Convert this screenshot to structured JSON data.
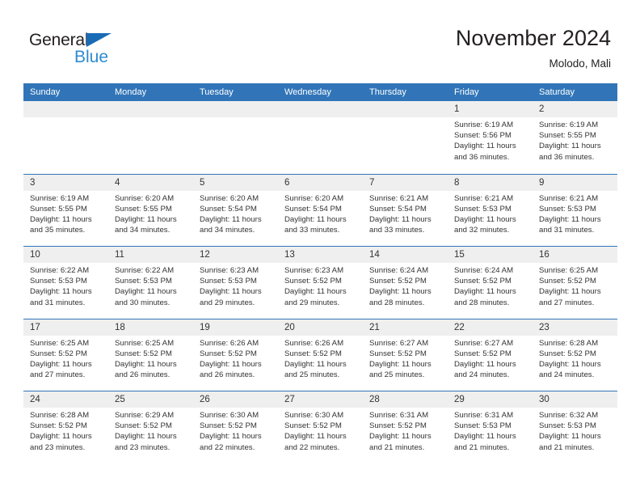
{
  "brand": {
    "name_part1": "General",
    "name_part2": "Blue",
    "flag_icon": "blue-triangle-flag",
    "color_dark": "#231f20",
    "color_blue": "#2e8bd0"
  },
  "header": {
    "title": "November 2024",
    "subtitle": "Molodo, Mali",
    "weekday_header_bg": "#3175b8",
    "weekday_header_fg": "#ffffff"
  },
  "weekdays": [
    "Sunday",
    "Monday",
    "Tuesday",
    "Wednesday",
    "Thursday",
    "Friday",
    "Saturday"
  ],
  "weeks": [
    [
      {
        "day": "",
        "empty": true
      },
      {
        "day": "",
        "empty": true
      },
      {
        "day": "",
        "empty": true
      },
      {
        "day": "",
        "empty": true
      },
      {
        "day": "",
        "empty": true
      },
      {
        "day": "1",
        "sunrise": "Sunrise: 6:19 AM",
        "sunset": "Sunset: 5:56 PM",
        "daylight": "Daylight: 11 hours and 36 minutes."
      },
      {
        "day": "2",
        "sunrise": "Sunrise: 6:19 AM",
        "sunset": "Sunset: 5:55 PM",
        "daylight": "Daylight: 11 hours and 36 minutes."
      }
    ],
    [
      {
        "day": "3",
        "sunrise": "Sunrise: 6:19 AM",
        "sunset": "Sunset: 5:55 PM",
        "daylight": "Daylight: 11 hours and 35 minutes."
      },
      {
        "day": "4",
        "sunrise": "Sunrise: 6:20 AM",
        "sunset": "Sunset: 5:55 PM",
        "daylight": "Daylight: 11 hours and 34 minutes."
      },
      {
        "day": "5",
        "sunrise": "Sunrise: 6:20 AM",
        "sunset": "Sunset: 5:54 PM",
        "daylight": "Daylight: 11 hours and 34 minutes."
      },
      {
        "day": "6",
        "sunrise": "Sunrise: 6:20 AM",
        "sunset": "Sunset: 5:54 PM",
        "daylight": "Daylight: 11 hours and 33 minutes."
      },
      {
        "day": "7",
        "sunrise": "Sunrise: 6:21 AM",
        "sunset": "Sunset: 5:54 PM",
        "daylight": "Daylight: 11 hours and 33 minutes."
      },
      {
        "day": "8",
        "sunrise": "Sunrise: 6:21 AM",
        "sunset": "Sunset: 5:53 PM",
        "daylight": "Daylight: 11 hours and 32 minutes."
      },
      {
        "day": "9",
        "sunrise": "Sunrise: 6:21 AM",
        "sunset": "Sunset: 5:53 PM",
        "daylight": "Daylight: 11 hours and 31 minutes."
      }
    ],
    [
      {
        "day": "10",
        "sunrise": "Sunrise: 6:22 AM",
        "sunset": "Sunset: 5:53 PM",
        "daylight": "Daylight: 11 hours and 31 minutes."
      },
      {
        "day": "11",
        "sunrise": "Sunrise: 6:22 AM",
        "sunset": "Sunset: 5:53 PM",
        "daylight": "Daylight: 11 hours and 30 minutes."
      },
      {
        "day": "12",
        "sunrise": "Sunrise: 6:23 AM",
        "sunset": "Sunset: 5:53 PM",
        "daylight": "Daylight: 11 hours and 29 minutes."
      },
      {
        "day": "13",
        "sunrise": "Sunrise: 6:23 AM",
        "sunset": "Sunset: 5:52 PM",
        "daylight": "Daylight: 11 hours and 29 minutes."
      },
      {
        "day": "14",
        "sunrise": "Sunrise: 6:24 AM",
        "sunset": "Sunset: 5:52 PM",
        "daylight": "Daylight: 11 hours and 28 minutes."
      },
      {
        "day": "15",
        "sunrise": "Sunrise: 6:24 AM",
        "sunset": "Sunset: 5:52 PM",
        "daylight": "Daylight: 11 hours and 28 minutes."
      },
      {
        "day": "16",
        "sunrise": "Sunrise: 6:25 AM",
        "sunset": "Sunset: 5:52 PM",
        "daylight": "Daylight: 11 hours and 27 minutes."
      }
    ],
    [
      {
        "day": "17",
        "sunrise": "Sunrise: 6:25 AM",
        "sunset": "Sunset: 5:52 PM",
        "daylight": "Daylight: 11 hours and 27 minutes."
      },
      {
        "day": "18",
        "sunrise": "Sunrise: 6:25 AM",
        "sunset": "Sunset: 5:52 PM",
        "daylight": "Daylight: 11 hours and 26 minutes."
      },
      {
        "day": "19",
        "sunrise": "Sunrise: 6:26 AM",
        "sunset": "Sunset: 5:52 PM",
        "daylight": "Daylight: 11 hours and 26 minutes."
      },
      {
        "day": "20",
        "sunrise": "Sunrise: 6:26 AM",
        "sunset": "Sunset: 5:52 PM",
        "daylight": "Daylight: 11 hours and 25 minutes."
      },
      {
        "day": "21",
        "sunrise": "Sunrise: 6:27 AM",
        "sunset": "Sunset: 5:52 PM",
        "daylight": "Daylight: 11 hours and 25 minutes."
      },
      {
        "day": "22",
        "sunrise": "Sunrise: 6:27 AM",
        "sunset": "Sunset: 5:52 PM",
        "daylight": "Daylight: 11 hours and 24 minutes."
      },
      {
        "day": "23",
        "sunrise": "Sunrise: 6:28 AM",
        "sunset": "Sunset: 5:52 PM",
        "daylight": "Daylight: 11 hours and 24 minutes."
      }
    ],
    [
      {
        "day": "24",
        "sunrise": "Sunrise: 6:28 AM",
        "sunset": "Sunset: 5:52 PM",
        "daylight": "Daylight: 11 hours and 23 minutes."
      },
      {
        "day": "25",
        "sunrise": "Sunrise: 6:29 AM",
        "sunset": "Sunset: 5:52 PM",
        "daylight": "Daylight: 11 hours and 23 minutes."
      },
      {
        "day": "26",
        "sunrise": "Sunrise: 6:30 AM",
        "sunset": "Sunset: 5:52 PM",
        "daylight": "Daylight: 11 hours and 22 minutes."
      },
      {
        "day": "27",
        "sunrise": "Sunrise: 6:30 AM",
        "sunset": "Sunset: 5:52 PM",
        "daylight": "Daylight: 11 hours and 22 minutes."
      },
      {
        "day": "28",
        "sunrise": "Sunrise: 6:31 AM",
        "sunset": "Sunset: 5:52 PM",
        "daylight": "Daylight: 11 hours and 21 minutes."
      },
      {
        "day": "29",
        "sunrise": "Sunrise: 6:31 AM",
        "sunset": "Sunset: 5:53 PM",
        "daylight": "Daylight: 11 hours and 21 minutes."
      },
      {
        "day": "30",
        "sunrise": "Sunrise: 6:32 AM",
        "sunset": "Sunset: 5:53 PM",
        "daylight": "Daylight: 11 hours and 21 minutes."
      }
    ]
  ]
}
